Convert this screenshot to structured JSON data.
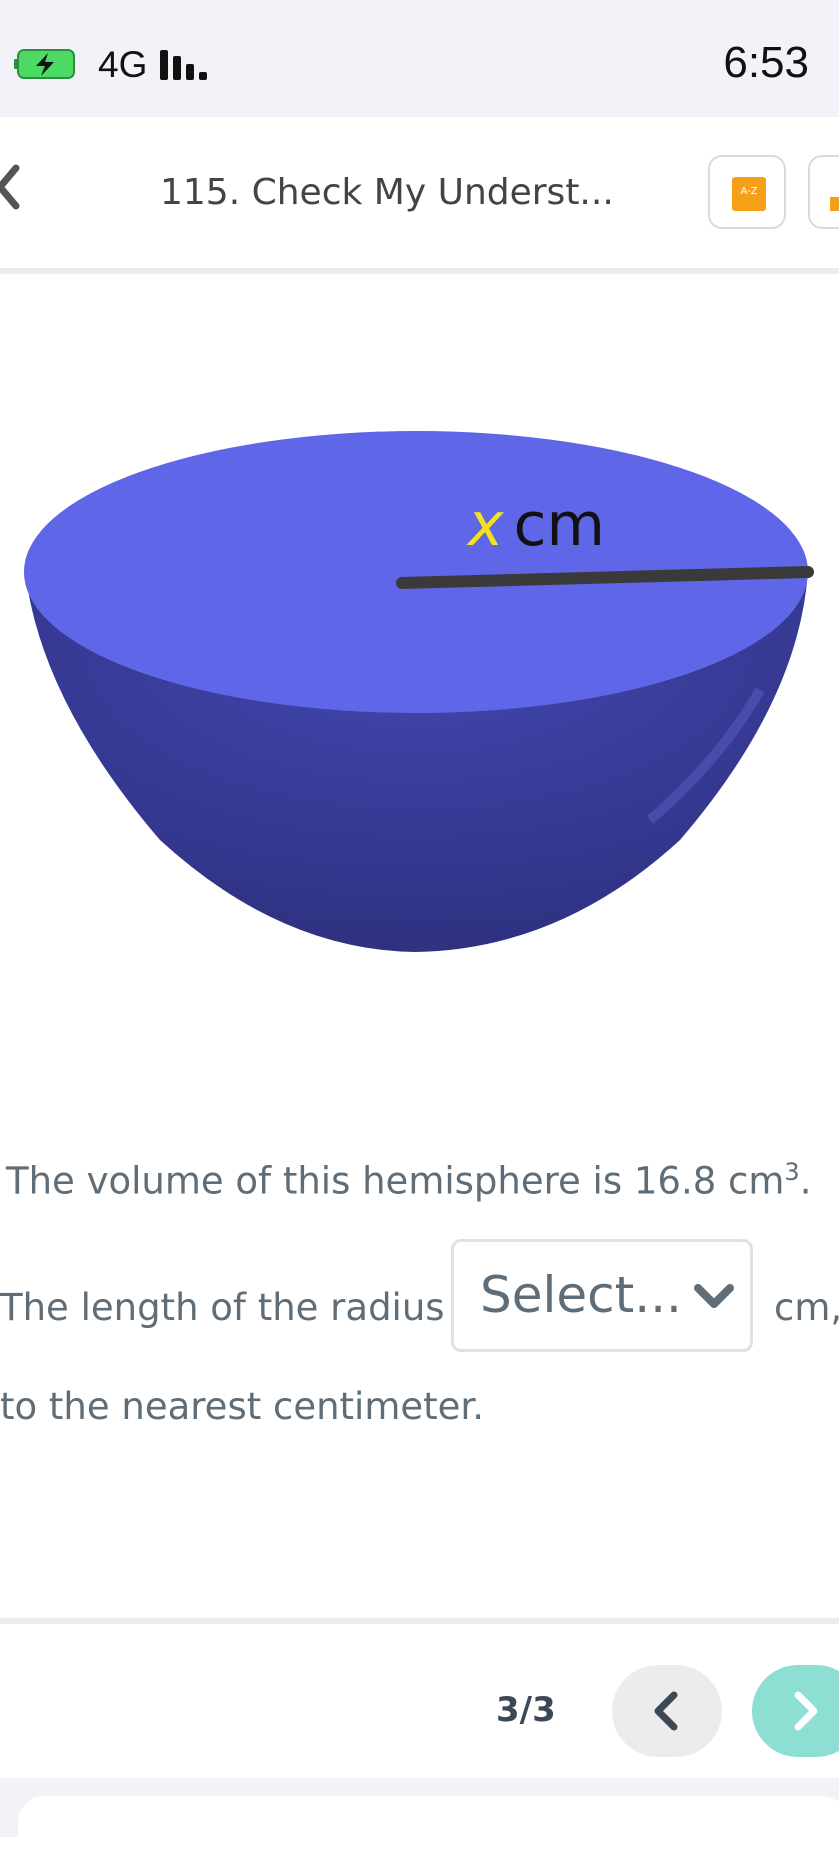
{
  "status": {
    "network": "4G",
    "time": "6:53"
  },
  "header": {
    "title": "115. Check My Underst...",
    "glossary_badge": "A-Z"
  },
  "figure": {
    "label_var": "x",
    "label_unit": "cm"
  },
  "question": {
    "line1_prefix": "The volume of this hemisphere is 16.8 cm",
    "line1_exp": "3",
    "line1_suffix": ".",
    "line2_prefix": "The length of the radius is",
    "select_placeholder": "Select...",
    "line2_suffix": "cm,",
    "line3": "to the nearest centimeter."
  },
  "pager": {
    "label": "3/3"
  },
  "colors": {
    "accent": "#8dded3",
    "shape_top": "#6066e8",
    "shape_body": "#3a3fa0",
    "badge": "#f6a01a"
  }
}
